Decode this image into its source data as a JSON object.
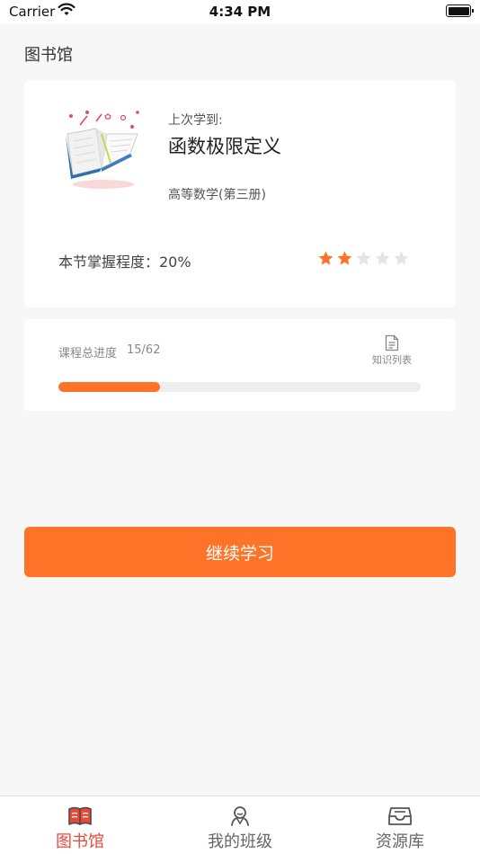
{
  "status_bar": {
    "carrier": "Carrier",
    "time": "4:34 PM",
    "battery_level": 1.0
  },
  "page": {
    "title": "图书馆"
  },
  "last_study": {
    "label": "上次学到:",
    "chapter": "函数极限定义",
    "book": "高等数学(第三册)",
    "mastery_text": "本节掌握程度：20%",
    "stars_filled": 2,
    "stars_total": 5,
    "star_color": "#ff7328",
    "star_empty_color": "#e4e4e4"
  },
  "course_progress": {
    "label": "课程总进度",
    "count": "15/62",
    "fraction": 0.28,
    "knowledge_list_label": "知识列表",
    "icon": "document-icon"
  },
  "continue_button": {
    "label": "继续学习",
    "color": "#ff7328"
  },
  "tabs": [
    {
      "label": "图书馆",
      "icon": "library-icon",
      "active": true
    },
    {
      "label": "我的班级",
      "icon": "class-icon",
      "active": false
    },
    {
      "label": "资源库",
      "icon": "resource-box-icon",
      "active": false
    }
  ],
  "colors": {
    "accent": "#ff7328",
    "active_tab": "#e84838"
  }
}
